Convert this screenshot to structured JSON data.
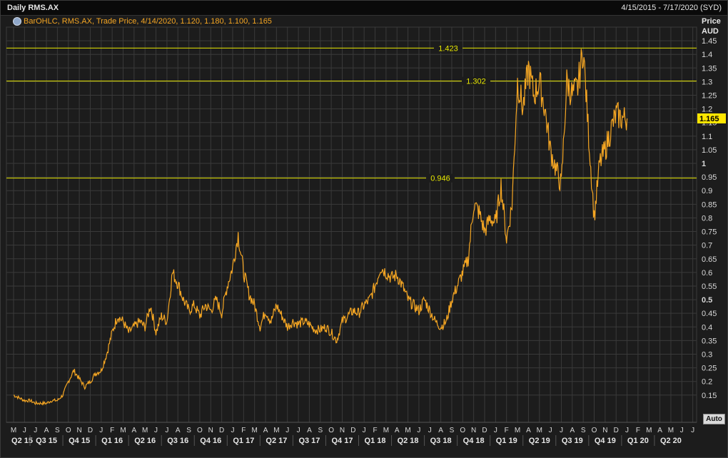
{
  "window": {
    "title": "Daily RMS.AX",
    "date_range": "4/15/2015 - 7/17/2020 (SYD)"
  },
  "legend": {
    "text": "BarOHLC, RMS.AX, Trade Price,  4/14/2020, 1.120, 1.180, 1.100, 1.165"
  },
  "axis": {
    "title_line1": "Price",
    "title_line2": "AUD",
    "auto_button": "Auto"
  },
  "colors": {
    "background": "#1c1c1c",
    "grid": "#3a3a3a",
    "series": "#f5a623",
    "hline": "#e8e800",
    "last_price_bg": "#ffe600"
  },
  "chart_data": {
    "type": "line",
    "title": "Daily RMS.AX",
    "ylabel": "Price AUD",
    "ylim": [
      0.05,
      1.5
    ],
    "y_ticks": [
      "0.15",
      "0.2",
      "0.25",
      "0.3",
      "0.35",
      "0.4",
      "0.45",
      "0.5",
      "0.55",
      "0.6",
      "0.65",
      "0.7",
      "0.75",
      "0.8",
      "0.85",
      "0.9",
      "0.95",
      "1",
      "1.05",
      "1.1",
      "1.15",
      "1.2",
      "1.25",
      "1.3",
      "1.35",
      "1.4",
      "1.45"
    ],
    "bold_y_ticks": [
      "0.5",
      "1"
    ],
    "last_price": 1.165,
    "last_price_label": "1.165",
    "hlines": [
      {
        "value": 1.423,
        "label": "1.423"
      },
      {
        "value": 1.302,
        "label": "1.302"
      },
      {
        "value": 0.946,
        "label": "0.946"
      }
    ],
    "month_labels": [
      "M",
      "J",
      "J",
      "A",
      "S",
      "O",
      "N",
      "D",
      "J",
      "F",
      "M",
      "A",
      "M",
      "J",
      "J",
      "A",
      "S",
      "O",
      "N",
      "D",
      "J",
      "F",
      "M",
      "A",
      "M",
      "J",
      "J",
      "A",
      "S",
      "O",
      "N",
      "D",
      "J",
      "F",
      "M",
      "A",
      "M",
      "J",
      "J",
      "A",
      "S",
      "O",
      "N",
      "D",
      "J",
      "F",
      "M",
      "A",
      "M",
      "J",
      "J",
      "A",
      "S",
      "O",
      "N",
      "D",
      "J",
      "F",
      "M",
      "A",
      "M",
      "J",
      "J"
    ],
    "quarter_labels": [
      "Q2 15",
      "Q3 15",
      "Q4 15",
      "Q1 16",
      "Q2 16",
      "Q3 16",
      "Q4 16",
      "Q1 17",
      "Q2 17",
      "Q3 17",
      "Q4 17",
      "Q1 18",
      "Q2 18",
      "Q3 18",
      "Q4 18",
      "Q1 19",
      "Q2 19",
      "Q3 19",
      "Q4 19",
      "Q1 20",
      "Q2 20"
    ],
    "series": [
      {
        "x_month_index": [
          0,
          0.5,
          1,
          1.5,
          2,
          2.5,
          3,
          3.5,
          4,
          4.5,
          5,
          5.5,
          6,
          6.5,
          7,
          7.5,
          8,
          8.5,
          9,
          9.5,
          10,
          10.5,
          11,
          11.5,
          12,
          12.5,
          13,
          13.5,
          14,
          14.5,
          15,
          15.5,
          16,
          16.5,
          17,
          17.5,
          18,
          18.5,
          19,
          19.5,
          20,
          20.5,
          21,
          21.5,
          22,
          22.5,
          23,
          23.5,
          24,
          24.5,
          25,
          25.5,
          26,
          26.5,
          27,
          27.5,
          28,
          28.5,
          29,
          29.5,
          30,
          30.5,
          31,
          31.5,
          32,
          32.5,
          33,
          33.5,
          34,
          34.5,
          35,
          35.5,
          36,
          36.5,
          37,
          37.5,
          38,
          38.5,
          39,
          39.5,
          40,
          40.5,
          41,
          41.5,
          42,
          42.5,
          43,
          43.5,
          44,
          44.5,
          45,
          45.5,
          46,
          46.5,
          47,
          47.5,
          48,
          48.5,
          49,
          49.5,
          50,
          50.5,
          51,
          51.5,
          52,
          52.5,
          53,
          53.5,
          54,
          54.5,
          55,
          55.5,
          56,
          56.5,
          57,
          57.5,
          58,
          58.5,
          59,
          59.5,
          60,
          60.5,
          61,
          61.5,
          62,
          62.5
        ],
        "values": [
          0.15,
          0.14,
          0.13,
          0.13,
          0.12,
          0.12,
          0.12,
          0.13,
          0.13,
          0.15,
          0.2,
          0.24,
          0.21,
          0.18,
          0.2,
          0.23,
          0.24,
          0.3,
          0.38,
          0.44,
          0.42,
          0.38,
          0.4,
          0.42,
          0.4,
          0.48,
          0.38,
          0.44,
          0.42,
          0.6,
          0.56,
          0.5,
          0.46,
          0.48,
          0.44,
          0.48,
          0.46,
          0.5,
          0.45,
          0.55,
          0.62,
          0.74,
          0.6,
          0.52,
          0.48,
          0.4,
          0.46,
          0.42,
          0.48,
          0.44,
          0.4,
          0.42,
          0.41,
          0.42,
          0.41,
          0.39,
          0.39,
          0.4,
          0.38,
          0.35,
          0.42,
          0.44,
          0.46,
          0.45,
          0.48,
          0.5,
          0.55,
          0.62,
          0.6,
          0.58,
          0.59,
          0.55,
          0.5,
          0.48,
          0.46,
          0.5,
          0.46,
          0.42,
          0.4,
          0.42,
          0.5,
          0.55,
          0.6,
          0.65,
          0.85,
          0.82,
          0.75,
          0.8,
          0.78,
          0.92,
          0.72,
          0.85,
          1.3,
          1.2,
          1.35,
          1.25,
          1.3,
          1.2,
          1.05,
          0.98,
          0.92,
          1.3,
          1.25,
          1.28,
          1.42,
          1.1,
          0.8,
          1.0,
          1.05,
          1.12,
          1.18,
          1.165,
          1.165
        ]
      }
    ]
  }
}
